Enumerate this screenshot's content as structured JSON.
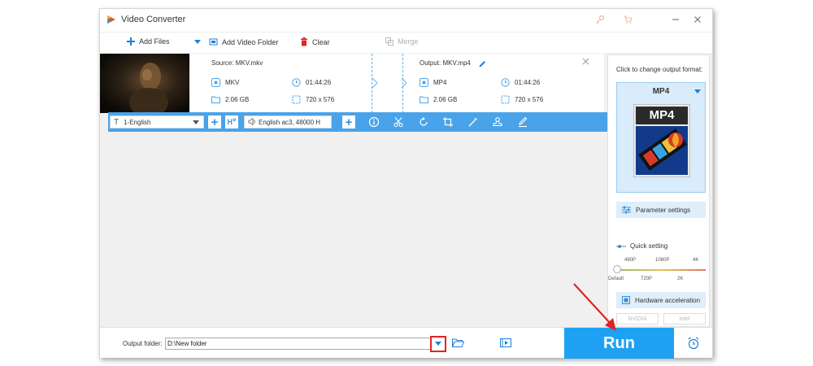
{
  "window": {
    "title": "Video Converter"
  },
  "toolbar": {
    "add_files": "Add Files",
    "add_video_folder": "Add Video Folder",
    "clear": "Clear",
    "merge": "Merge"
  },
  "file": {
    "source_label": "Source: MKV.mkv",
    "output_label": "Output: MKV.mp4",
    "source": {
      "format": "MKV",
      "duration": "01:44:26",
      "size": "2.06 GB",
      "resolution": "720 x 576"
    },
    "output": {
      "format": "MP4",
      "duration": "01:44:26",
      "size": "2.06 GB",
      "resolution": "720 x 576"
    }
  },
  "editbar": {
    "subtitle": "1-English",
    "audio": "English ac3, 48000 H"
  },
  "right_panel": {
    "format_prompt": "Click to change output format:",
    "format_name": "MP4",
    "format_badge": "MP4",
    "parameter_settings": "Parameter settings",
    "quick_setting": "Quick setting",
    "slider_top": [
      "480P",
      "1080P",
      "4K"
    ],
    "slider_bottom": [
      "Default",
      "720P",
      "2K"
    ],
    "hardware_acceleration": "Hardware acceleration",
    "gpu_nvidia": "NVIDIA",
    "gpu_intel": "Intel"
  },
  "bottom": {
    "output_folder_label": "Output folder:",
    "output_folder_value": "D:\\New folder",
    "run_label": "Run"
  },
  "colors": {
    "accent_blue": "#1ea1f2",
    "bar_blue": "#4aa3e8",
    "annotation_red": "#e02424"
  }
}
